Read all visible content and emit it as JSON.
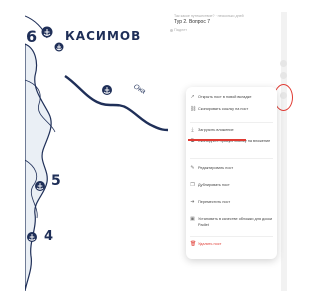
{
  "map": {
    "city_label": "КАСИМОВ",
    "river_label": "Ока",
    "markers": [
      "6",
      "5",
      "4"
    ],
    "colors": {
      "ink": "#1f2f58",
      "river_fill": "#eaeff5",
      "paper": "#ffffff"
    }
  },
  "post": {
    "meta": "Так какое путешествие? · несколько дней",
    "title": "Тур 2. Вопрос 7",
    "author": "Падлет"
  },
  "context_menu": {
    "items": [
      {
        "icon": "external-link-icon",
        "glyph": "↗",
        "label": "Открыть пост в новой вкладке",
        "danger": false
      },
      {
        "icon": "link-icon",
        "glyph": "⛓",
        "label": "Скопировать ссылку на пост",
        "danger": false
      },
      {
        "icon": "download-icon",
        "glyph": "⤓",
        "label": "Загрузить вложение",
        "danger": false
      },
      {
        "icon": "copy-link-icon",
        "glyph": "⧉",
        "label": "Скопируйте прямую ссылку на вложение",
        "danger": false
      },
      {
        "icon": "pencil-icon",
        "glyph": "✎",
        "label": "Редактировать пост",
        "danger": false
      },
      {
        "icon": "duplicate-icon",
        "glyph": "❐",
        "label": "Дублировать пост",
        "danger": false
      },
      {
        "icon": "move-icon",
        "glyph": "➜",
        "label": "Переместить пост",
        "danger": false
      },
      {
        "icon": "image-icon",
        "glyph": "▣",
        "label": "Установить в качестве обложки для доски Padlet",
        "danger": false
      },
      {
        "icon": "trash-icon",
        "glyph": "🗑",
        "label": "Удалить пост",
        "danger": true
      }
    ]
  },
  "annotation": {
    "ring_color": "#e03a32",
    "underline_color": "#e03a32"
  }
}
